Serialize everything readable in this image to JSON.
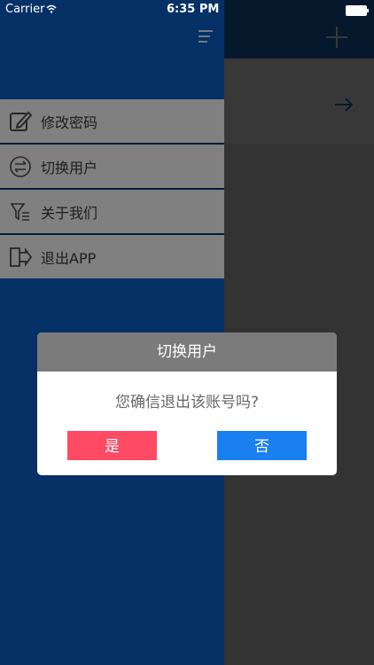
{
  "status_bar": {
    "carrier": "Carrier",
    "time": "6:35 PM"
  },
  "main": {
    "add_icon": "plus-icon",
    "row_icon": "arrow-right-icon"
  },
  "drawer": {
    "menu_icon": "hamburger-icon",
    "items": [
      {
        "label": "修改密码",
        "icon": "edit-icon"
      },
      {
        "label": "切换用户",
        "icon": "swap-icon"
      },
      {
        "label": "关于我们",
        "icon": "about-icon"
      },
      {
        "label": "退出APP",
        "icon": "exit-icon"
      }
    ]
  },
  "dialog": {
    "title": "切换用户",
    "message": "您确信退出该账号吗?",
    "confirm_label": "是",
    "cancel_label": "否"
  },
  "colors": {
    "drawer_bg": "#0a55b0",
    "dialog_header": "#7b7b7b",
    "confirm_button": "#ff4a64",
    "cancel_button": "#1a7ff0"
  }
}
